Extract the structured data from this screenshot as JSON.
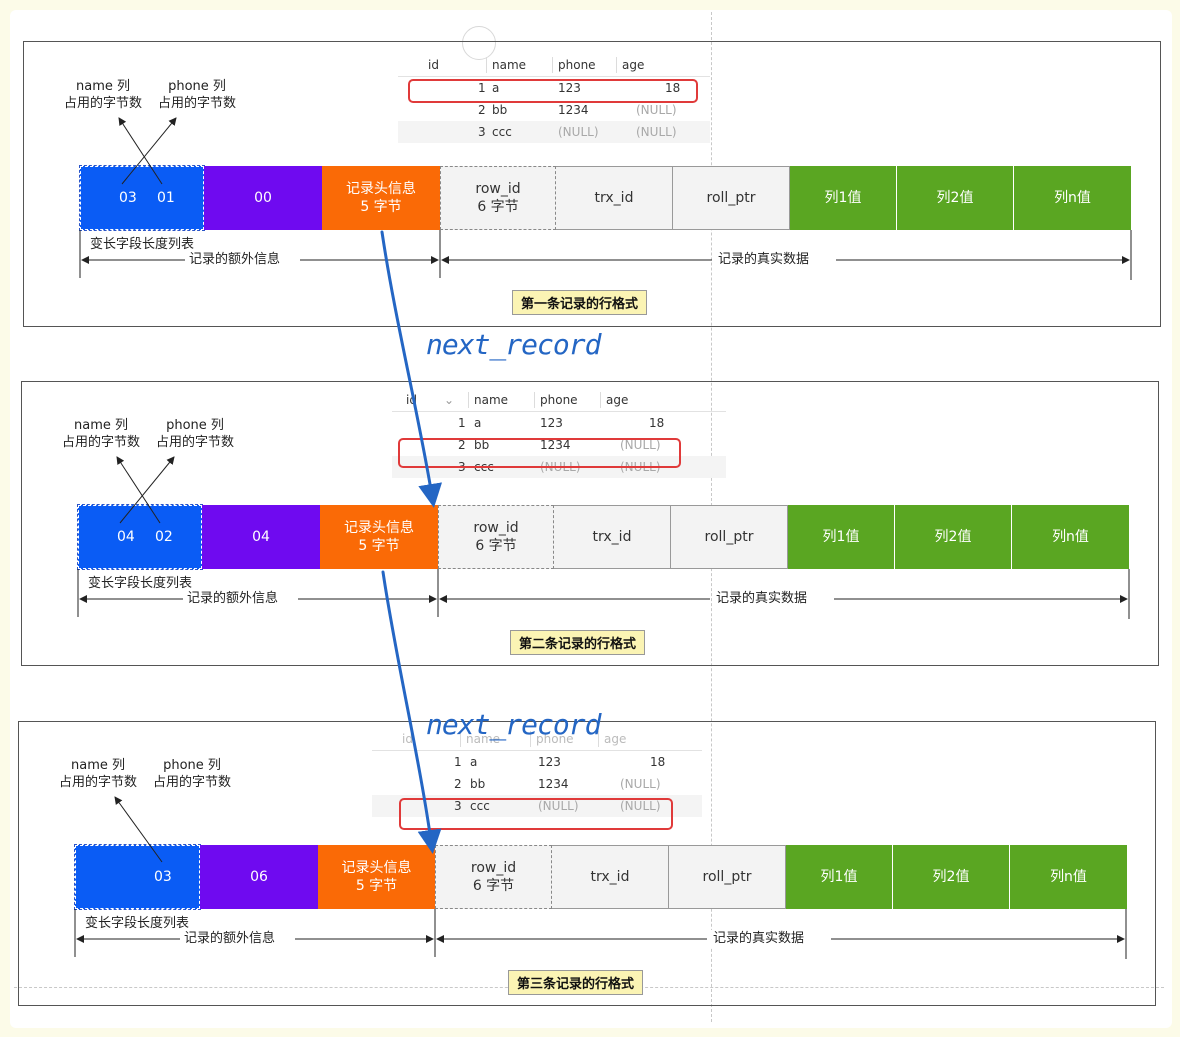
{
  "table": {
    "headers": [
      "id",
      "name",
      "phone",
      "age"
    ],
    "rows": [
      {
        "id": "1",
        "name": "a",
        "phone": "123",
        "age": "18"
      },
      {
        "id": "2",
        "name": "bb",
        "phone": "1234",
        "age": "(NULL)"
      },
      {
        "id": "3",
        "name": "ccc",
        "phone": "(NULL)",
        "age": "(NULL)"
      }
    ]
  },
  "labels": {
    "name_col": "name 列",
    "name_bytes": "占用的字节数",
    "phone_col": "phone 列",
    "phone_bytes": "占用的字节数",
    "varlen_list": "变长字段长度列表",
    "extra_info": "记录的额外信息",
    "real_data": "记录的真实数据",
    "header_info": "记录头信息",
    "header_size": "5 字节",
    "row_id": "row_id",
    "row_id_size": "6 字节",
    "trx_id": "trx_id",
    "roll_ptr": "roll_ptr",
    "col1": "列1值",
    "col2": "列2值",
    "coln": "列n值",
    "next_record": "next_record"
  },
  "records": [
    {
      "caption": "第一条记录的行格式",
      "varlen_a": "03",
      "varlen_b": "01",
      "null_list": "00",
      "highlight_row": 1
    },
    {
      "caption": "第二条记录的行格式",
      "varlen_a": "04",
      "varlen_b": "02",
      "null_list": "04",
      "highlight_row": 2
    },
    {
      "caption": "第三条记录的行格式",
      "varlen_a": "03",
      "varlen_b": "",
      "null_list": "06",
      "highlight_row": 3
    }
  ],
  "colors": {
    "varlen": "#0a5cf5",
    "null_list": "#6f0af0",
    "header": "#fa6a06",
    "hidden_cols": "#f3f3f3",
    "user_cols": "#5aa622",
    "highlight": "#e03a3a",
    "arrow": "#2466c4",
    "caption_bg": "#fbf4b4"
  }
}
